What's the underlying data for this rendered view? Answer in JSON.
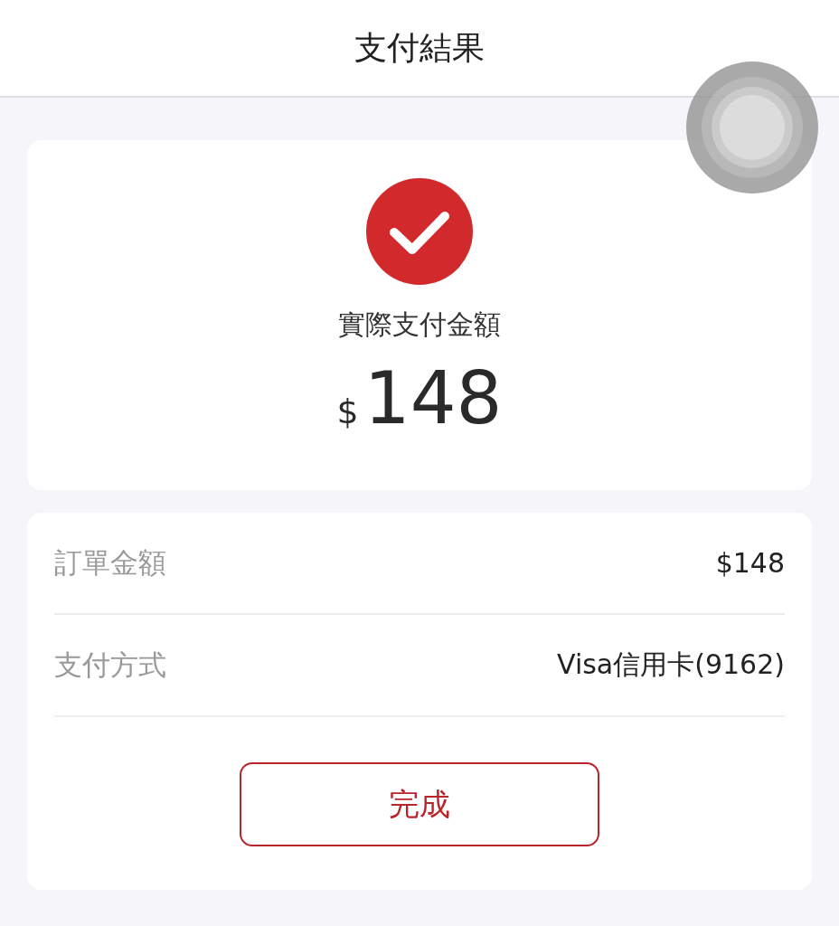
{
  "header": {
    "title": "支付結果"
  },
  "result": {
    "success": true,
    "label": "實際支付金額",
    "currency": "$",
    "amount": "148"
  },
  "details": [
    {
      "label": "訂單金額",
      "value": "$148"
    },
    {
      "label": "支付方式",
      "value": "Visa信用卡(9162)"
    }
  ],
  "button": {
    "label": "完成"
  }
}
